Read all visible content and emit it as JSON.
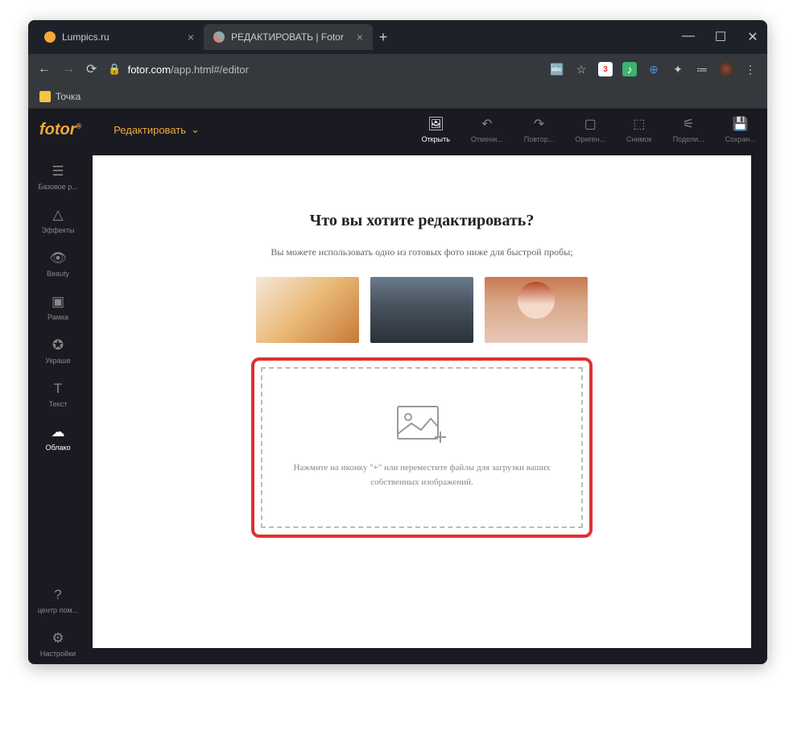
{
  "browser": {
    "tabs": [
      {
        "title": "Lumpics.ru",
        "favicon_color": "#f4a938"
      },
      {
        "title": "РЕДАКТИРОВАТЬ | Fotor",
        "favicon_color": "#4ecdc4"
      }
    ],
    "url_host": "fotor.com",
    "url_path": "/app.html#/editor",
    "bookmark": "Точка"
  },
  "app": {
    "logo": "fotor",
    "edit_button": "Редактировать",
    "toolbar": [
      {
        "label": "Открыть",
        "icon": "image-icon",
        "active": true
      },
      {
        "label": "Отмени...",
        "icon": "undo-icon"
      },
      {
        "label": "Повтор...",
        "icon": "redo-icon"
      },
      {
        "label": "Ориген...",
        "icon": "picture-icon"
      },
      {
        "label": "Снимок",
        "icon": "camera-icon"
      },
      {
        "label": "Подели...",
        "icon": "share-icon"
      },
      {
        "label": "Сохран...",
        "icon": "save-icon"
      }
    ],
    "sidebar": [
      {
        "label": "Базовое р...",
        "icon": "sliders-icon"
      },
      {
        "label": "Эффекты",
        "icon": "effects-icon"
      },
      {
        "label": "Beauty",
        "icon": "eye-icon"
      },
      {
        "label": "Рамка",
        "icon": "frame-icon"
      },
      {
        "label": "Украше",
        "icon": "star-icon"
      },
      {
        "label": "Текст",
        "icon": "text-icon"
      },
      {
        "label": "Облако",
        "icon": "cloud-icon",
        "highlight": true
      }
    ],
    "sidebar_bottom": [
      {
        "label": "центр пом...",
        "icon": "help-icon"
      },
      {
        "label": "Настройки",
        "icon": "gear-icon"
      }
    ]
  },
  "main": {
    "heading": "Что вы хотите редактировать?",
    "subtext": "Вы можете использовать одно из готовых фото ниже для быстрой пробы;",
    "drop_text": "Нажмите на иконку \"+\" или переместите файлы для загрузки ваших собственных изображений."
  }
}
